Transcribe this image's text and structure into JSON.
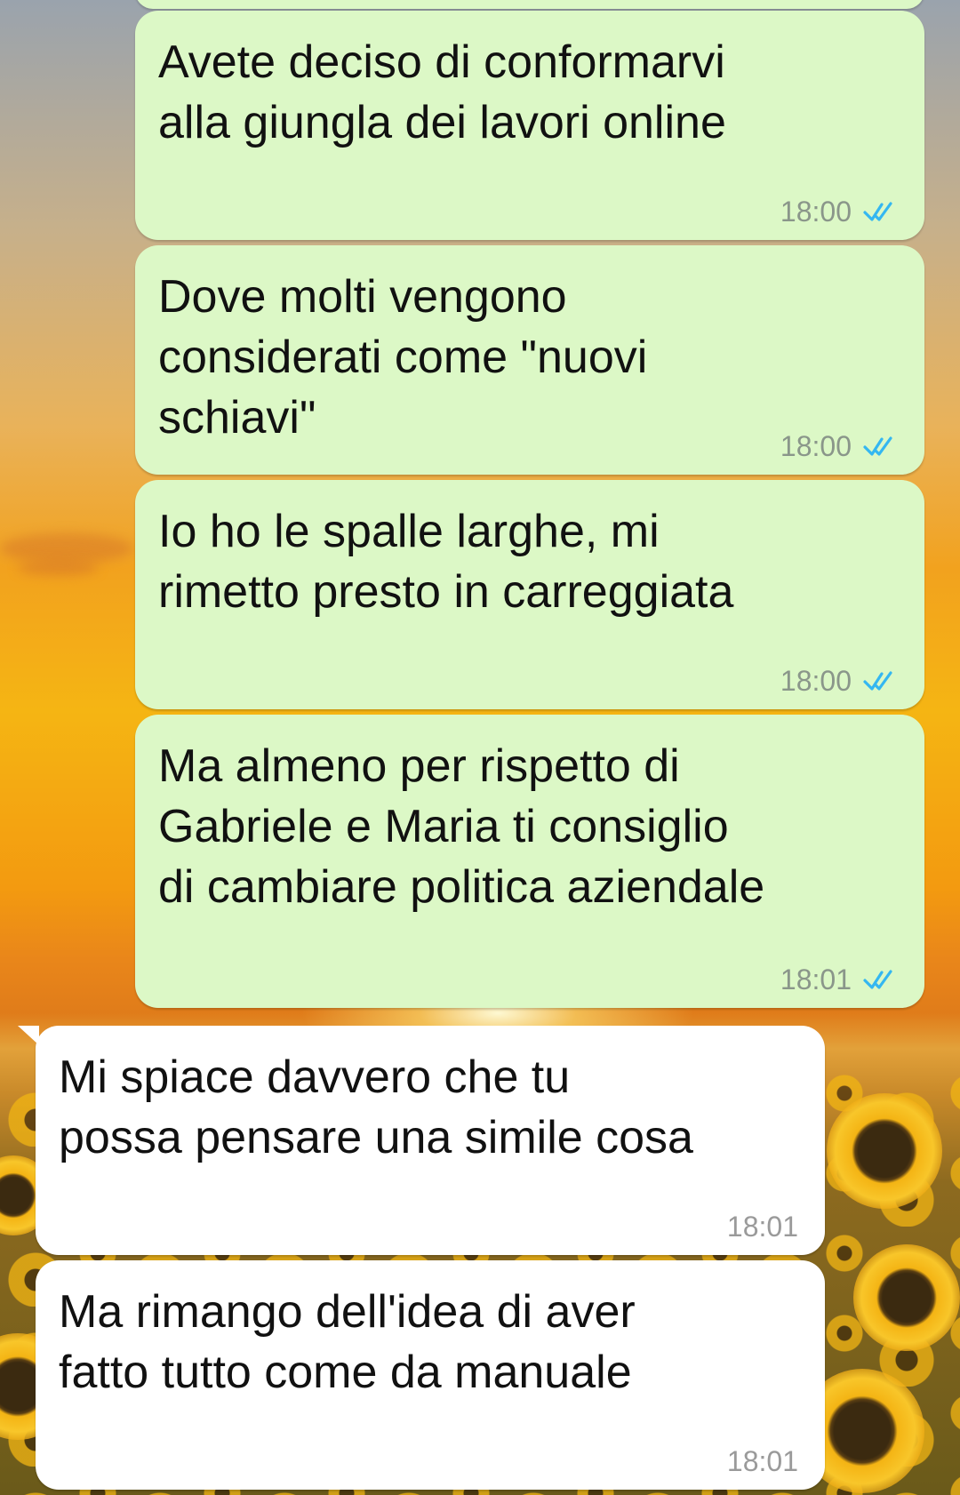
{
  "theme": {
    "outgoing_bubble": "#dcf8c6",
    "incoming_bubble": "#ffffff",
    "read_tick_color": "#34b7f1",
    "wallpaper": "sunset-sunflower-field"
  },
  "messages": [
    {
      "direction": "outgoing",
      "text": "Avete deciso di conformarvi\nalla giungla dei lavori online",
      "time": "18:00",
      "status_icon": "double-check-read-icon"
    },
    {
      "direction": "outgoing",
      "text": "Dove molti vengono\nconsiderati come \"nuovi\nschiavi\"",
      "time": "18:00",
      "status_icon": "double-check-read-icon"
    },
    {
      "direction": "outgoing",
      "text": "Io ho le spalle larghe, mi\nrimetto presto in carreggiata",
      "time": "18:00",
      "status_icon": "double-check-read-icon"
    },
    {
      "direction": "outgoing",
      "text": "Ma almeno per rispetto di\nGabriele e Maria ti consiglio\ndi cambiare politica aziendale",
      "time": "18:01",
      "status_icon": "double-check-read-icon"
    },
    {
      "direction": "incoming",
      "text": "Mi spiace davvero che tu\npossa pensare una simile cosa",
      "time": "18:01"
    },
    {
      "direction": "incoming",
      "text": "Ma rimango dell'idea di aver\nfatto tutto come da manuale",
      "time": "18:01"
    }
  ]
}
